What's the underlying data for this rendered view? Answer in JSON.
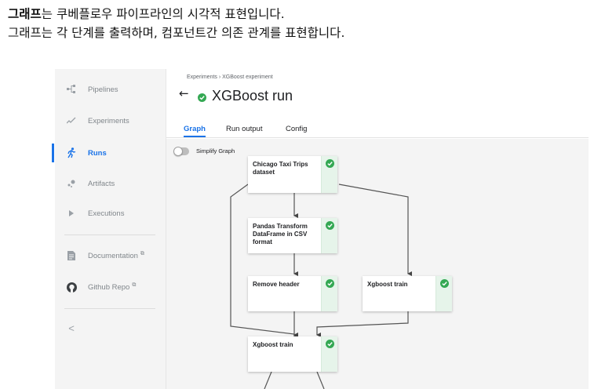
{
  "caption": {
    "line1_bold": "그래프",
    "line1_rest": "는 쿠베플로우 파이프라인의 시각적 표현입니다.",
    "line2": "그래프는 각 단계를 출력하며, 컴포넌트간 의존 관계를 표현합니다."
  },
  "sidebar": {
    "items": [
      {
        "label": "Pipelines",
        "icon": "pipelines-icon"
      },
      {
        "label": "Experiments",
        "icon": "experiments-icon"
      },
      {
        "label": "Runs",
        "icon": "runs-icon",
        "active": true
      },
      {
        "label": "Artifacts",
        "icon": "artifacts-icon"
      },
      {
        "label": "Executions",
        "icon": "executions-icon"
      },
      {
        "label": "Documentation",
        "icon": "documentation-icon",
        "external": true
      },
      {
        "label": "Github Repo",
        "icon": "github-icon",
        "external": true
      }
    ],
    "collapse": "<"
  },
  "header": {
    "breadcrumb": "Experiments  ›  XGBoost experiment",
    "title": "XGBoost run",
    "status": "succeeded"
  },
  "tabs": [
    {
      "label": "Graph",
      "active": true
    },
    {
      "label": "Run output"
    },
    {
      "label": "Config"
    }
  ],
  "graph": {
    "simplify_label": "Simplify Graph",
    "simplify_on": false,
    "nodes": [
      {
        "label": "Chicago Taxi Trips dataset",
        "status": "succeeded"
      },
      {
        "label": "Pandas Transform DataFrame in CSV format",
        "status": "succeeded"
      },
      {
        "label": "Remove header",
        "status": "succeeded"
      },
      {
        "label": "Xgboost train",
        "status": "succeeded"
      },
      {
        "label": "Xgboost train",
        "status": "succeeded"
      }
    ]
  },
  "colors": {
    "accent": "#1a73e8",
    "success": "#34a853",
    "success_bg": "#e6f4ea",
    "sidebar_bg": "#f4f4f4"
  }
}
